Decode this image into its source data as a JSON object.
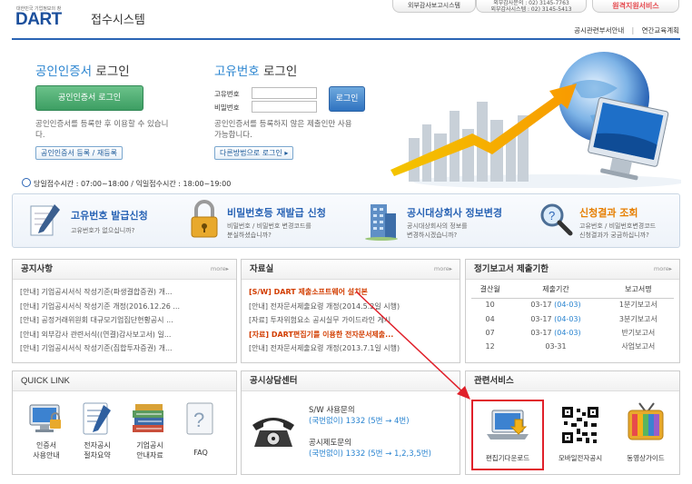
{
  "header": {
    "logo_small": "대한민국 기업정보의 창",
    "logo": "DART",
    "logo_sub": "접수시스템",
    "tab_audit": "외부감사보고시스템",
    "tab_contact_line1": "외부감사문의 : 02) 3145-7763",
    "tab_contact_line2": "외부감사시스템 : 02) 3145-5413",
    "tab_remote": "원격지원서비스",
    "link_dept": "공시관련부서안내",
    "link_sep": "|",
    "link_edu": "연간교육계획"
  },
  "cert_login": {
    "title_blue": "공인인증서",
    "title_rest": "로그인",
    "button": "공인인증서 로그인",
    "desc": "공인인증서를 등록한 후 이용할 수 있습니다.",
    "register_button": "공인인증서 등록 / 재등록"
  },
  "id_login": {
    "title_blue": "고유번호",
    "title_rest": "로그인",
    "id_label": "고유번호",
    "pw_label": "비밀번호",
    "id_value": "",
    "pw_value": "",
    "button": "로그인",
    "desc": "공인인증서를 등록하지 않은 제출인만 사용 가능합니다.",
    "other_button": "다른방법으로 로그인 ▸"
  },
  "hours": {
    "text": "당일접수시간 : 07:00~18:00 / 익일접수시간 : 18:00~19:00"
  },
  "services": [
    {
      "title": "고유번호 발급신청",
      "desc1": "고유번호가 없으십니까?",
      "desc2": "",
      "icon": "pen-document-icon"
    },
    {
      "title": "비밀번호등 재발급 신청",
      "desc1": "비밀번호 / 비밀번호 변경코드를",
      "desc2": "분실하셨습니까?",
      "icon": "lock-icon"
    },
    {
      "title": "공시대상회사 정보변경",
      "desc1": "공시대상회사의 정보를",
      "desc2": "변경하시겠습니까?",
      "icon": "building-icon"
    },
    {
      "title": "신청결과 조회",
      "desc1": "고유번호 / 비밀번호변경코드",
      "desc2": "신청결과가 궁금하십니까?",
      "icon": "magnifier-icon"
    }
  ],
  "notice": {
    "title": "공지사항",
    "more": "more▸",
    "items": [
      "[안내] 기업공시서식 작성기준(파생결합증권) 개...",
      "[안내] 기업공시서식 작성기준 개정(2016.12.26 ...",
      "[안내] 공정거래위원회 대규모기업집단현황공시 ...",
      "[안내] 외부감사 관련서식((연결)감사보고서) 일...",
      "[안내] 기업공시서식 작성기준(집합투자증권) 개..."
    ]
  },
  "library": {
    "title": "자료실",
    "more": "more▸",
    "items": [
      {
        "text": "[S/W] DART 제출소프트웨어 설치본",
        "highlight": true
      },
      {
        "text": "[안내] 전자문서제출요령 개정(2014.5.2일 시행)",
        "highlight": false
      },
      {
        "text": "[자료] 투자위험요소 공시실무 가이드라인 게시",
        "highlight": false
      },
      {
        "text": "[자료] DART편집기를 이용한 전자문서제출...",
        "highlight": true
      },
      {
        "text": "[안내] 전자문서제출요령 개정(2013.7.1일 시행)",
        "highlight": false
      }
    ]
  },
  "deadline": {
    "title": "정기보고서 제출기한",
    "more": "more▸",
    "headers": [
      "결산월",
      "제출기간",
      "보고서명"
    ],
    "rows": [
      {
        "month": "10",
        "start": "03-17",
        "end": "(04-03)",
        "name": "1분기보고서"
      },
      {
        "month": "04",
        "start": "03-17",
        "end": "(04-03)",
        "name": "3분기보고서"
      },
      {
        "month": "07",
        "start": "03-17",
        "end": "(04-03)",
        "name": "반기보고서"
      },
      {
        "month": "12",
        "start": "03-31",
        "end": "",
        "name": "사업보고서"
      }
    ]
  },
  "quick_link": {
    "title": "QUICK LINK",
    "items": [
      {
        "label1": "인증서",
        "label2": "사용안내",
        "icon": "monitor-lock-icon"
      },
      {
        "label1": "전자공시",
        "label2": "절차요약",
        "icon": "notebook-pen-icon"
      },
      {
        "label1": "기업공시",
        "label2": "안내자료",
        "icon": "books-icon"
      },
      {
        "label1": "FAQ",
        "label2": "",
        "icon": "question-icon"
      }
    ]
  },
  "consult": {
    "title": "공시상담센터",
    "sw_title": "S/W 사용문의",
    "sw_line": "(국번없이) 1332 (5번 → 4번)",
    "sys_title": "공시제도문의",
    "sys_line": "(국번없이) 1332 (5번 → 1,2,3,5번)"
  },
  "related": {
    "title": "관련서비스",
    "items": [
      {
        "label": "편집기다운로드",
        "icon": "laptop-download-icon"
      },
      {
        "label": "모바일전자공시",
        "icon": "qr-code-icon"
      },
      {
        "label": "동영상가이드",
        "icon": "tv-icon"
      }
    ]
  },
  "colors": {
    "brand": "#1b4f9c",
    "accent": "#2a84d0",
    "highlight_red": "#e0202a",
    "green_button": "#3d9e63"
  }
}
